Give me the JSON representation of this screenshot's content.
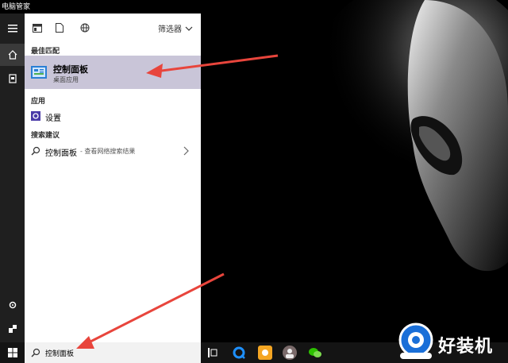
{
  "desktop": {
    "label": "电脑管家"
  },
  "panel": {
    "toolbar": {
      "filter_label": "筛选器"
    },
    "best_match": {
      "section_title": "最佳匹配",
      "title": "控制面板",
      "subtitle": "桌面应用"
    },
    "apps": {
      "section_title": "应用",
      "items": [
        {
          "label": "设置"
        }
      ]
    },
    "suggestions": {
      "section_title": "搜索建议",
      "items": [
        {
          "label": "控制面板",
          "sub": "- 查看网络搜索结果"
        }
      ]
    }
  },
  "taskbar": {
    "search_text": "控制面板"
  },
  "watermark": {
    "text": "好装机"
  },
  "colors": {
    "selection": "#c9c5d8",
    "annotation_arrow": "#e8453c",
    "rail": "#1f1f1f",
    "taskbar": "#141414"
  }
}
